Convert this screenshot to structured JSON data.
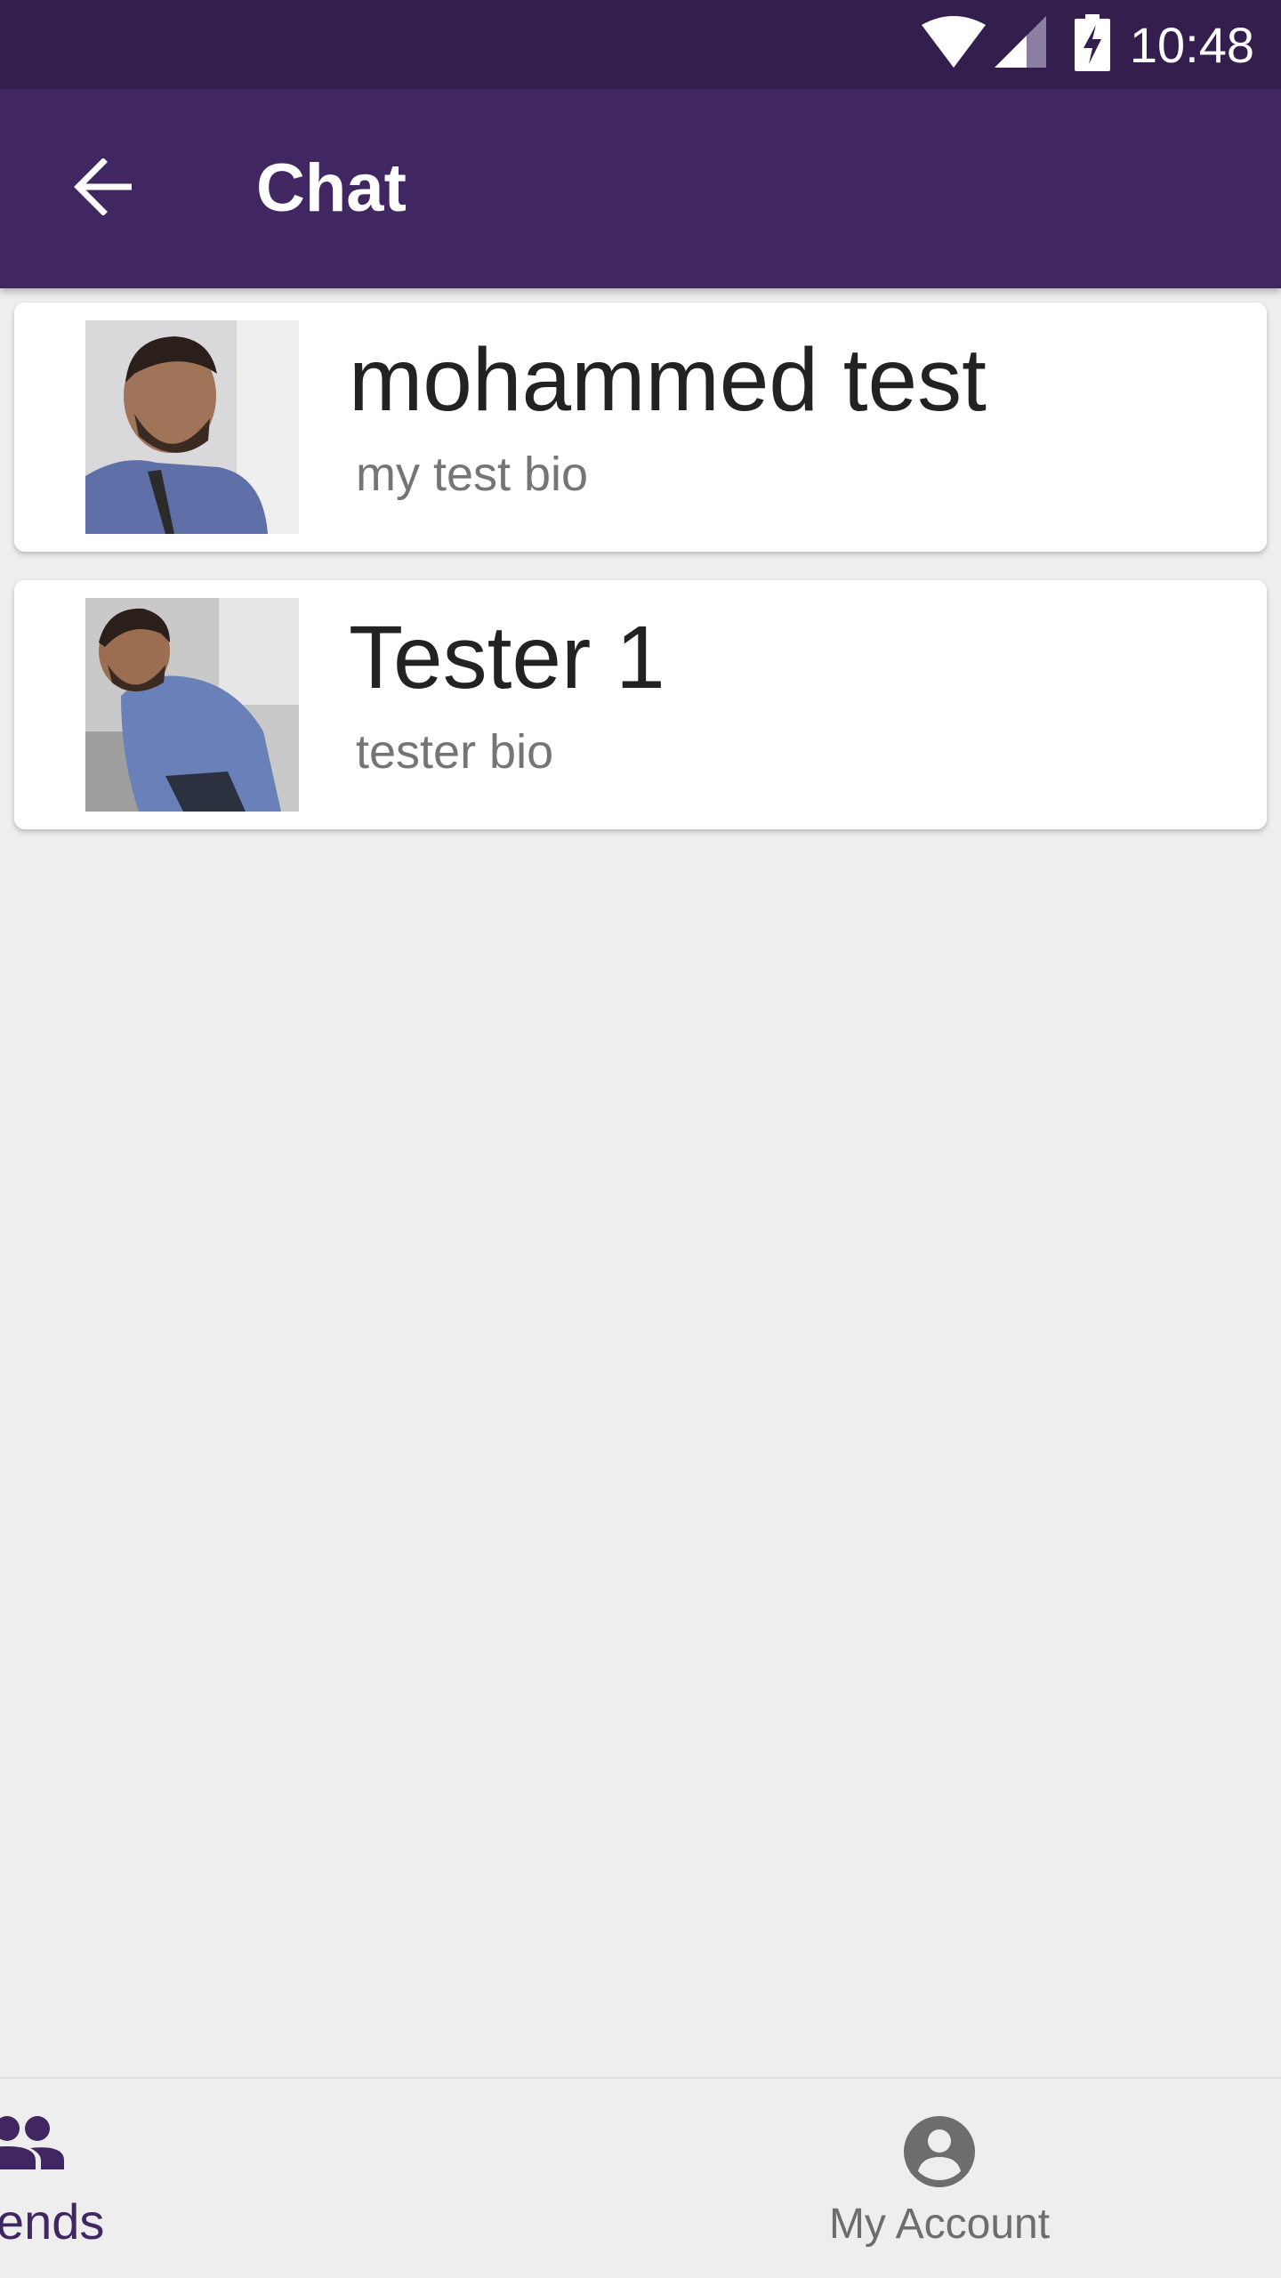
{
  "status_bar": {
    "time": "10:48",
    "icons": [
      "wifi-icon",
      "cell-signal-icon",
      "battery-charging-icon"
    ]
  },
  "toolbar": {
    "back_icon": "arrow-back-icon",
    "title": "Chat"
  },
  "friends": [
    {
      "name": "mohammed test",
      "bio": "my test bio",
      "avatar": "profile-photo"
    },
    {
      "name": "Tester 1",
      "bio": "tester bio",
      "avatar": "profile-photo"
    }
  ],
  "bottom_nav": {
    "items": [
      {
        "label": "Friends",
        "icon": "people-icon",
        "active": true
      },
      {
        "label": "My Account",
        "icon": "account-circle-icon",
        "active": false
      }
    ]
  },
  "colors": {
    "status_bar": "#341e4d",
    "toolbar": "#412761",
    "background": "#eeeeee",
    "active_nav": "#412761",
    "inactive_nav": "#6d6d6d"
  }
}
